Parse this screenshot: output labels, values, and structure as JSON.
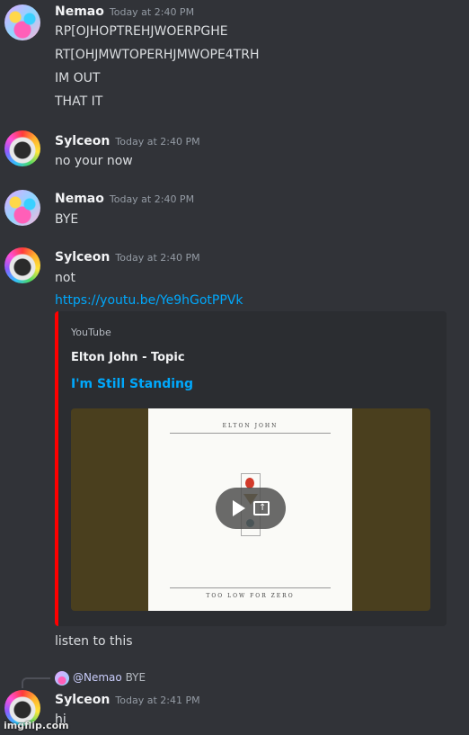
{
  "messages": [
    {
      "author": "Nemao",
      "timestamp": "Today at 2:40 PM",
      "lines": [
        "RP[OJHOPTREHJWOERPGHE",
        "RT[OHJMWTOPERHJMWOPE4TRH",
        "IM OUT",
        "THAT IT"
      ]
    },
    {
      "author": "Sylceon",
      "timestamp": "Today at 2:40 PM",
      "lines": [
        "no your now"
      ]
    },
    {
      "author": "Nemao",
      "timestamp": "Today at 2:40 PM",
      "lines": [
        "BYE"
      ]
    },
    {
      "author": "Sylceon",
      "timestamp": "Today at 2:40 PM",
      "lines": [
        "not",
        "https://youtu.be/Ye9hGotPPVk",
        "listen to this"
      ]
    },
    {
      "author": "Sylceon",
      "timestamp": "Today at 2:41 PM",
      "lines": [
        "hi"
      ]
    }
  ],
  "embed": {
    "provider": "YouTube",
    "author": "Elton John - Topic",
    "title": "I'm Still Standing",
    "accent_color": "#ff0000",
    "album_artist": "ELTON JOHN",
    "album_title": "TOO LOW FOR ZERO"
  },
  "reply": {
    "mention": "@Nemao",
    "text": "BYE"
  },
  "watermark": "imgflip.com",
  "icons": [
    "play-icon",
    "popout-icon"
  ],
  "colors": {
    "background": "#313338",
    "link": "#00a8fc",
    "timestamp": "#949ba4"
  }
}
